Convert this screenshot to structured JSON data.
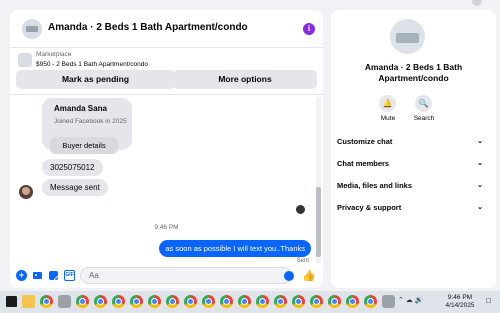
{
  "conversation": {
    "title": "Amanda · 2 Beds 1 Bath Apartment/condo",
    "info_icon": "i"
  },
  "marketplace": {
    "label": "Marketplace",
    "listing": "$950 - 2 Beds 1 Bath Apartment/condo"
  },
  "actions": {
    "mark_pending": "Mark as pending",
    "more_options": "More options"
  },
  "messages": {
    "profile_card": {
      "name": "Amanda Sana",
      "joined": "Joined Facebook in 2025",
      "button": "Buyer details"
    },
    "items": [
      {
        "from": "other",
        "text": "3025075012"
      },
      {
        "from": "other",
        "text": "Message sent"
      }
    ],
    "timestamp": "9:46 PM",
    "outgoing": "as soon as possible I will text you..Thanks",
    "status": "Sent"
  },
  "composer": {
    "placeholder": "Aa",
    "icons": [
      "plus-icon",
      "photo-icon",
      "sticker-icon",
      "gif-icon",
      "emoji-icon",
      "like-icon"
    ]
  },
  "info_panel": {
    "title": "Amanda · 2 Beds 1 Bath Apartment/condo",
    "mute_label": "Mute",
    "search_label": "Search",
    "sections": [
      "Customize chat",
      "Chat members",
      "Media, files and links",
      "Privacy & support"
    ]
  },
  "taskbar": {
    "time": "9:46 PM",
    "date": "4/14/2025"
  },
  "colors": {
    "accent": "#0866ff",
    "info_purple": "#8a2be2"
  }
}
